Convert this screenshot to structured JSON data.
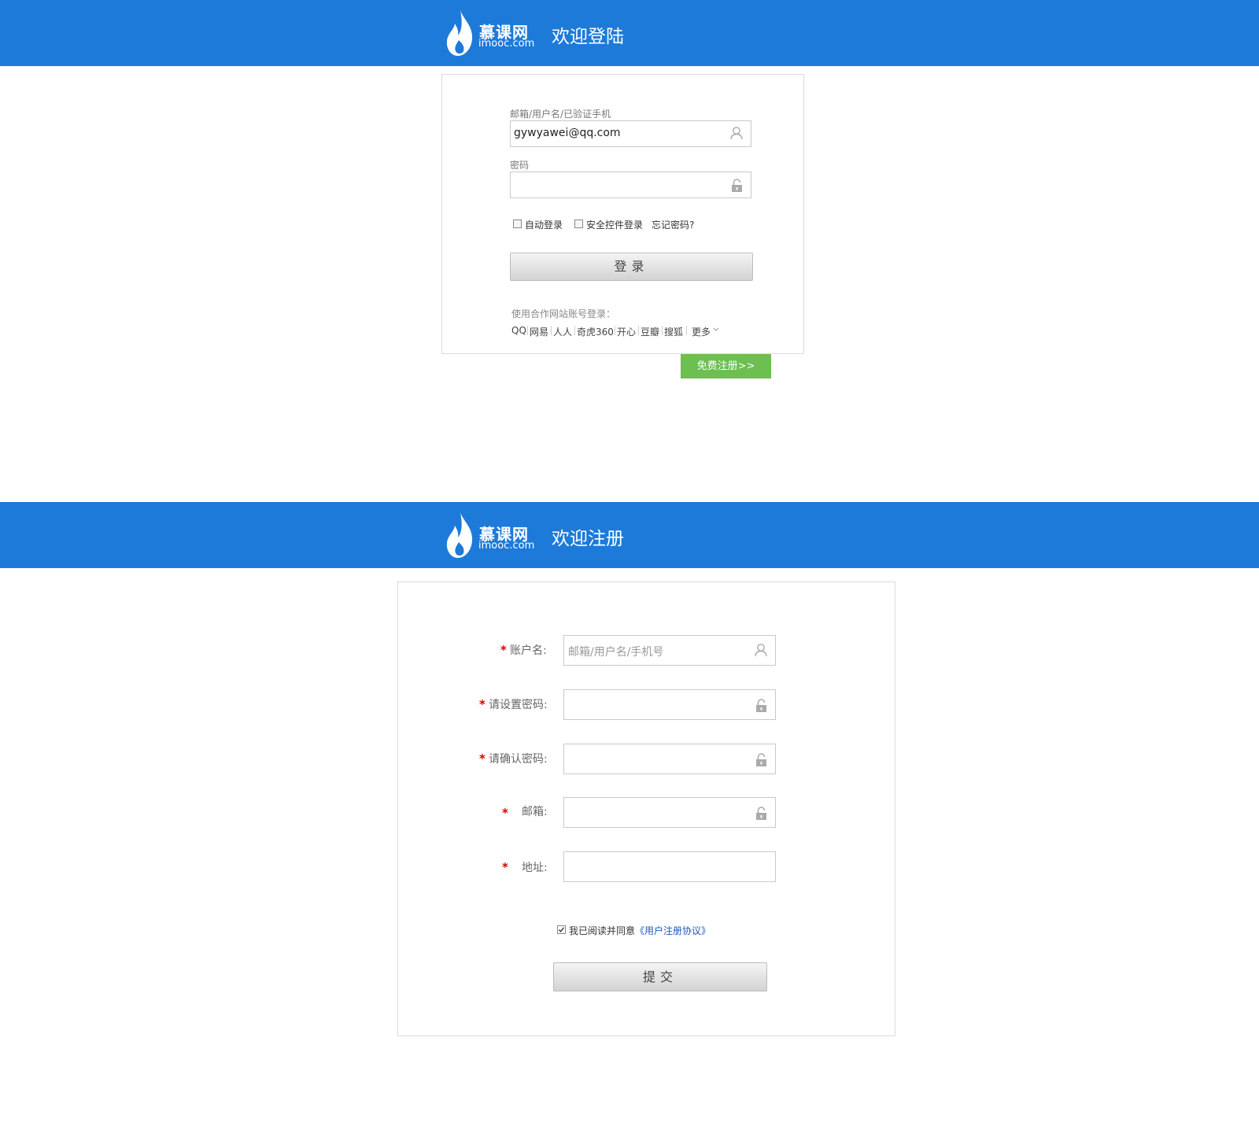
{
  "login": {
    "brand": {
      "name_cn": "慕课网",
      "name_en": "imooc.com"
    },
    "header_title": "欢迎登陆",
    "account_label": "邮箱/用户名/已验证手机",
    "account_value": "gywyawei@qq.com",
    "password_label": "密码",
    "auto_login": "自动登录",
    "secure_login": "安全控件登录",
    "forgot": "忘记密码?",
    "submit": "登录",
    "partner_label": "使用合作网站账号登录：",
    "partners": [
      "QQ",
      "网易",
      "人人",
      "奇虎360",
      "开心",
      "豆瓣",
      "搜狐",
      "更多"
    ],
    "register_link": "免费注册>>"
  },
  "register": {
    "brand": {
      "name_cn": "慕课网",
      "name_en": "imooc.com"
    },
    "header_title": "欢迎注册",
    "required_mark": "*",
    "fields": [
      {
        "label": "账户名:",
        "placeholder": "邮箱/用户名/手机号"
      },
      {
        "label": "请设置密码:",
        "placeholder": ""
      },
      {
        "label": "请确认密码:",
        "placeholder": ""
      },
      {
        "label": "邮箱:",
        "placeholder": ""
      },
      {
        "label": "地址:",
        "placeholder": ""
      }
    ],
    "agree_text": "我已阅读并同意",
    "agree_link": "《用户注册协议》",
    "submit": "提交"
  },
  "colors": {
    "header_bg": "#1e7ad8",
    "register_button": "#6cbf50",
    "required_star": "#dd0000",
    "agreement_link": "#1d5bb5"
  },
  "icons": [
    "flame-logo-icon",
    "user-icon",
    "lock-icon",
    "chevron-down-icon",
    "checkmark-icon"
  ]
}
